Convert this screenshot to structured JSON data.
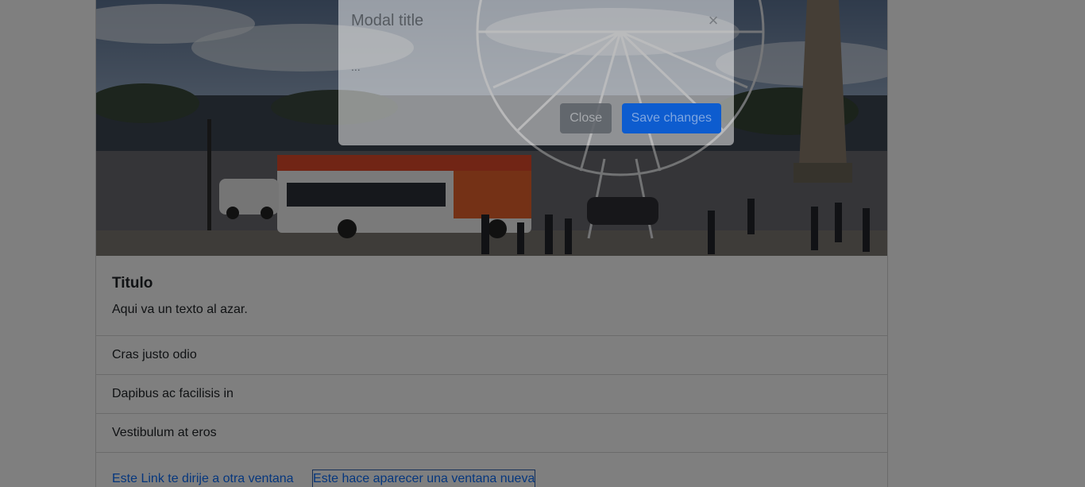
{
  "card": {
    "image_alt": "Place de la Concorde",
    "title": "Titulo",
    "text": "Aqui va un texto al azar.",
    "list_items": [
      "Cras justo odio",
      "Dapibus ac facilisis in",
      "Vestibulum at eros"
    ],
    "link_1": "Este Link te dirije a otra ventana",
    "link_2": "Este hace aparecer una ventana nueva"
  },
  "modal": {
    "title": "Modal title",
    "close_icon": "×",
    "body": "...",
    "close_button": "Close",
    "save_button": "Save changes"
  },
  "colors": {
    "link": "#0d6efd",
    "primary_button": "#0d5ccf",
    "backdrop": "rgba(0,0,0,0.5)"
  },
  "icons": {
    "modal_close": "close-icon"
  }
}
